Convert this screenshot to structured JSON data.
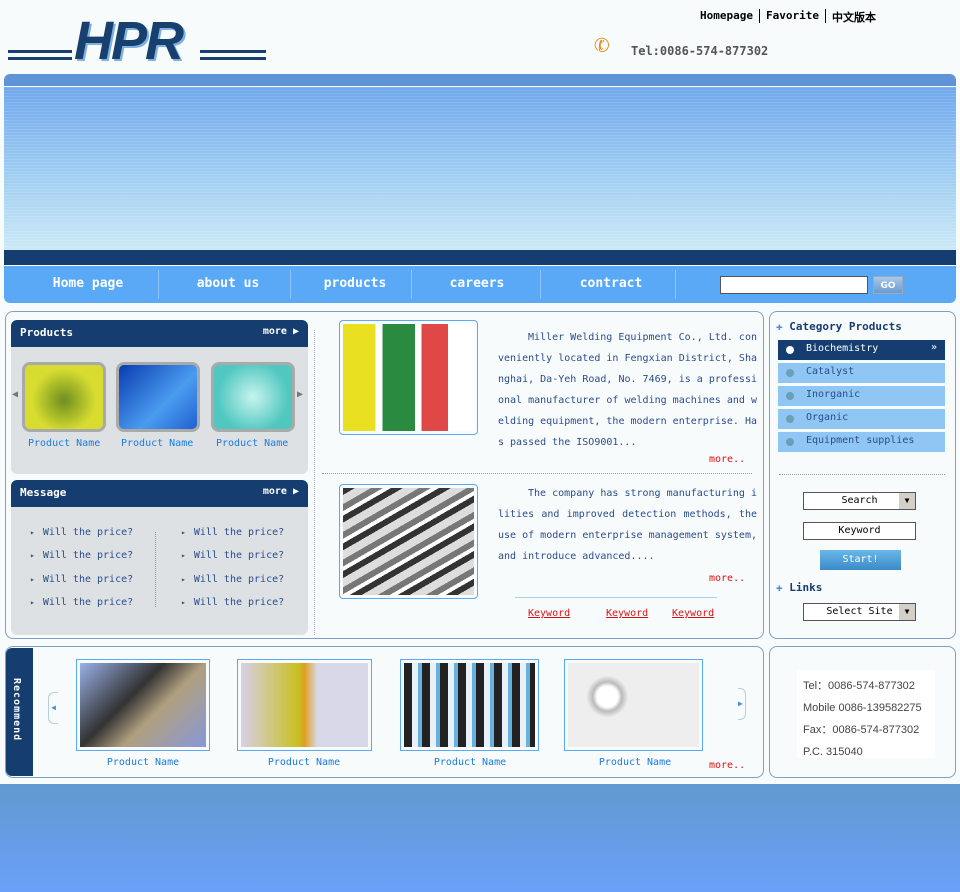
{
  "header": {
    "logo": "HPR",
    "links": [
      "Homepage",
      "Favorite",
      "中文版本"
    ],
    "tel": "Tel:0086-574-877302"
  },
  "nav": {
    "items": [
      "Home page",
      "about us",
      "products",
      "careers",
      "contract"
    ],
    "search_value": "",
    "go": "GO"
  },
  "products": {
    "title": "Products",
    "more": "more",
    "items": [
      "Product Name",
      "Product Name",
      "Product Name"
    ]
  },
  "message": {
    "title": "Message",
    "more": "more",
    "items": [
      "Will the price?",
      "Will the price?",
      "Will the price?",
      "Will the price?",
      "Will the price?",
      "Will the price?",
      "Will the price?",
      "Will the price?"
    ]
  },
  "news": [
    {
      "text": "Miller Welding Equipment Co., Ltd. conveniently located in Fengxian District, Shanghai, Da-Yeh Road, No. 7469, is a professional manufacturer of welding machines and welding equipment, the modern enterprise. Has passed the ISO9001...",
      "more": "more.."
    },
    {
      "text": "The company has strong manufacturing ilities and improved detection methods, the use of modern enterprise management system, and introduce advanced....",
      "more": "more.."
    }
  ],
  "keywords": [
    "Keyword",
    "Keyword",
    "Keyword"
  ],
  "sidebar": {
    "category_title": "Category Products",
    "categories": [
      "Biochemistry",
      "Catalyst",
      "Inorganic",
      "Organic",
      "Equipment supplies"
    ],
    "active": 0,
    "search_select": "Search",
    "keyword_placeholder": "Keyword",
    "start": "Start!",
    "links_title": "Links",
    "site_select": "Select Site"
  },
  "recommend": {
    "label": "Recommend",
    "items": [
      "Product Name",
      "Product Name",
      "Product Name",
      "Product Name"
    ],
    "more": "more.."
  },
  "contact": [
    "Tel：0086-574-877302",
    "Mobile 0086-139582275",
    "Fax：0086-574-877302",
    "P.C. 315040"
  ],
  "colors": {
    "navy": "#163d70",
    "nav": "#5aa9f7",
    "link": "#1a7be0",
    "red": "#e01010"
  }
}
